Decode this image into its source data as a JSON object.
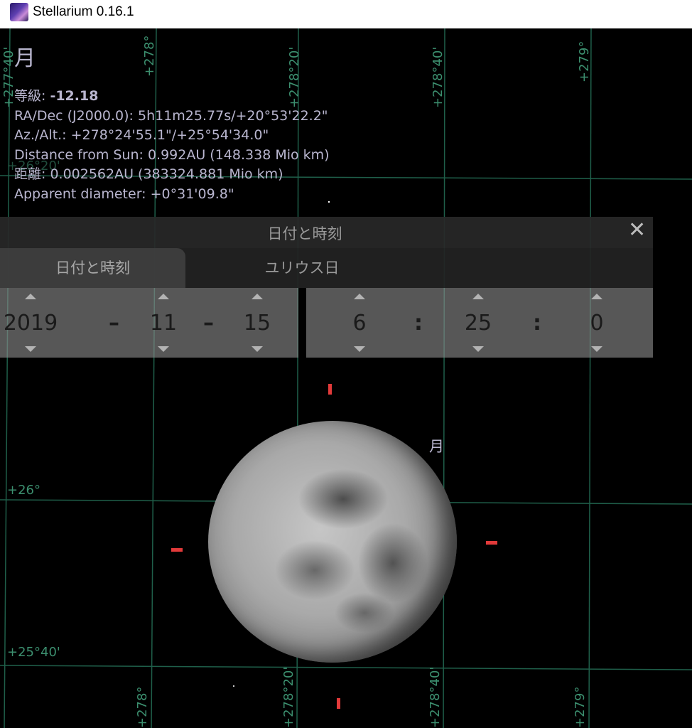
{
  "window": {
    "title": "Stellarium 0.16.1"
  },
  "info": {
    "object_name": "月",
    "magnitude_label": "等級: ",
    "magnitude_value": "-12.18",
    "ra_dec": "RA/Dec (J2000.0): 5h11m25.77s/+20°53'22.2\"",
    "az_alt": "Az./Alt.: +278°24'55.1\"/+25°54'34.0\"",
    "distance_sun": "Distance from Sun: 0.992AU (148.338 Mio km)",
    "distance": "距離: 0.002562AU (383324.881 Mio km)",
    "apparent_diameter": "Apparent diameter: +0°31'09.8\""
  },
  "grid_labels": {
    "az_top": [
      "+277°40'",
      "+278°",
      "+278°20'",
      "+278°40'",
      "+279°"
    ],
    "az_bottom": [
      "+278°",
      "+278°20'",
      "+278°40'",
      "+279°"
    ],
    "alt": [
      "+26°20'",
      "+26°",
      "+25°40'"
    ]
  },
  "sky_object_label": "月",
  "dialog": {
    "title": "日付と時刻",
    "tabs": [
      "日付と時刻",
      "ユリウス日"
    ],
    "date": {
      "year": "2019",
      "month": "11",
      "day": "15",
      "separator": "–"
    },
    "time": {
      "hour": "6",
      "minute": "25",
      "second": "0",
      "separator": ":"
    }
  },
  "colors": {
    "grid": "#1f5f4a",
    "grid_label": "#3c8f6f",
    "info_text": "#b9b6cf",
    "marker": "#e23a3a"
  }
}
